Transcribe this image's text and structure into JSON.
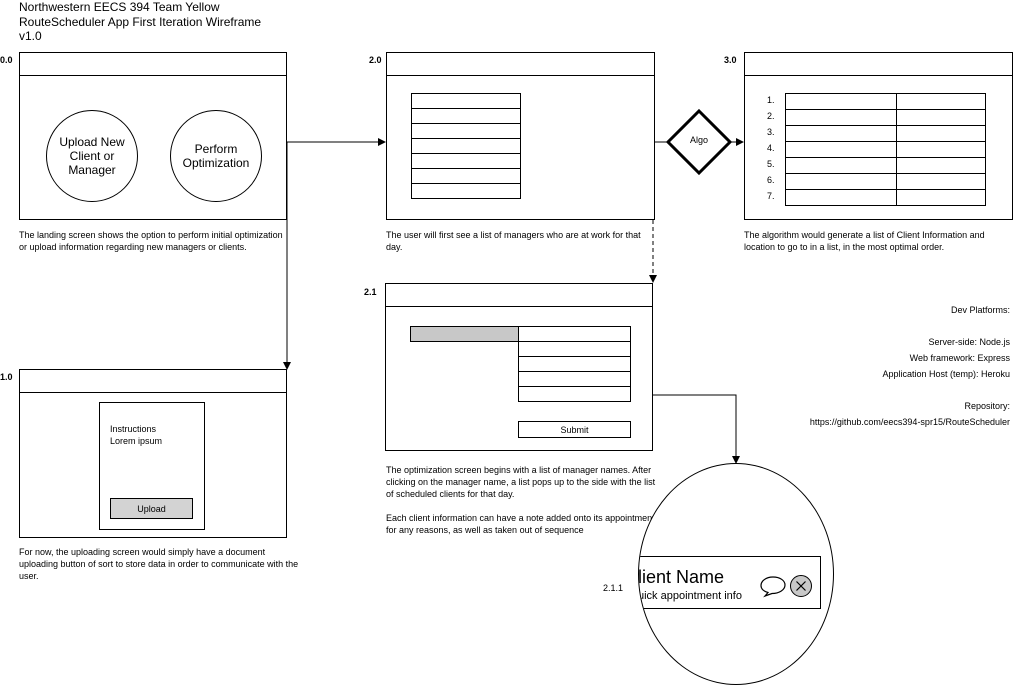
{
  "header": {
    "line1": "Northwestern EECS 394 Team Yellow",
    "line2": "RouteScheduler App First Iteration Wireframe",
    "line3": "v1.0"
  },
  "screens": {
    "s0": {
      "label": "0.0",
      "option_upload": "Upload New Client or Manager",
      "option_optimize": "Perform Optimization",
      "caption": "The landing screen shows the option to perform initial optimization or upload information regarding new managers or clients."
    },
    "s1": {
      "label": "1.0",
      "instructions_line1": "Instructions",
      "instructions_line2": "Lorem ipsum",
      "upload_label": "Upload",
      "caption": "For now, the uploading screen would simply have a document uploading button of sort to store data in order to communicate with the user."
    },
    "s2": {
      "label": "2.0",
      "caption": "The user will first see a list of managers who are at work for that day."
    },
    "algo": {
      "label": "Algo"
    },
    "s3": {
      "label": "3.0",
      "rows": [
        "1.",
        "2.",
        "3.",
        "4.",
        "5.",
        "6.",
        "7."
      ],
      "caption": "The algorithm would generate a list of Client Information and location to go to in a list, in the most optimal order."
    },
    "s21": {
      "label": "2.1",
      "submit_label": "Submit",
      "caption_p1": "The optimization screen begins with a list of manager names. After clicking on the manager name, a list pops up to the side with the list of scheduled clients for that day.",
      "caption_p2": "Each client information can have a note added onto its appointment for any reasons, as well as taken out of sequence"
    },
    "s211": {
      "label": "2.1.1",
      "client_name": "lient Name",
      "client_info": "uick appointment info"
    }
  },
  "dev": {
    "heading": "Dev Platforms:",
    "server": "Server-side: Node.js",
    "framework": "Web framework: Express",
    "host": "Application Host (temp): Heroku",
    "repo_heading": "Repository:",
    "repo_url": "https://github.com/eecs394-spr15/RouteScheduler"
  }
}
